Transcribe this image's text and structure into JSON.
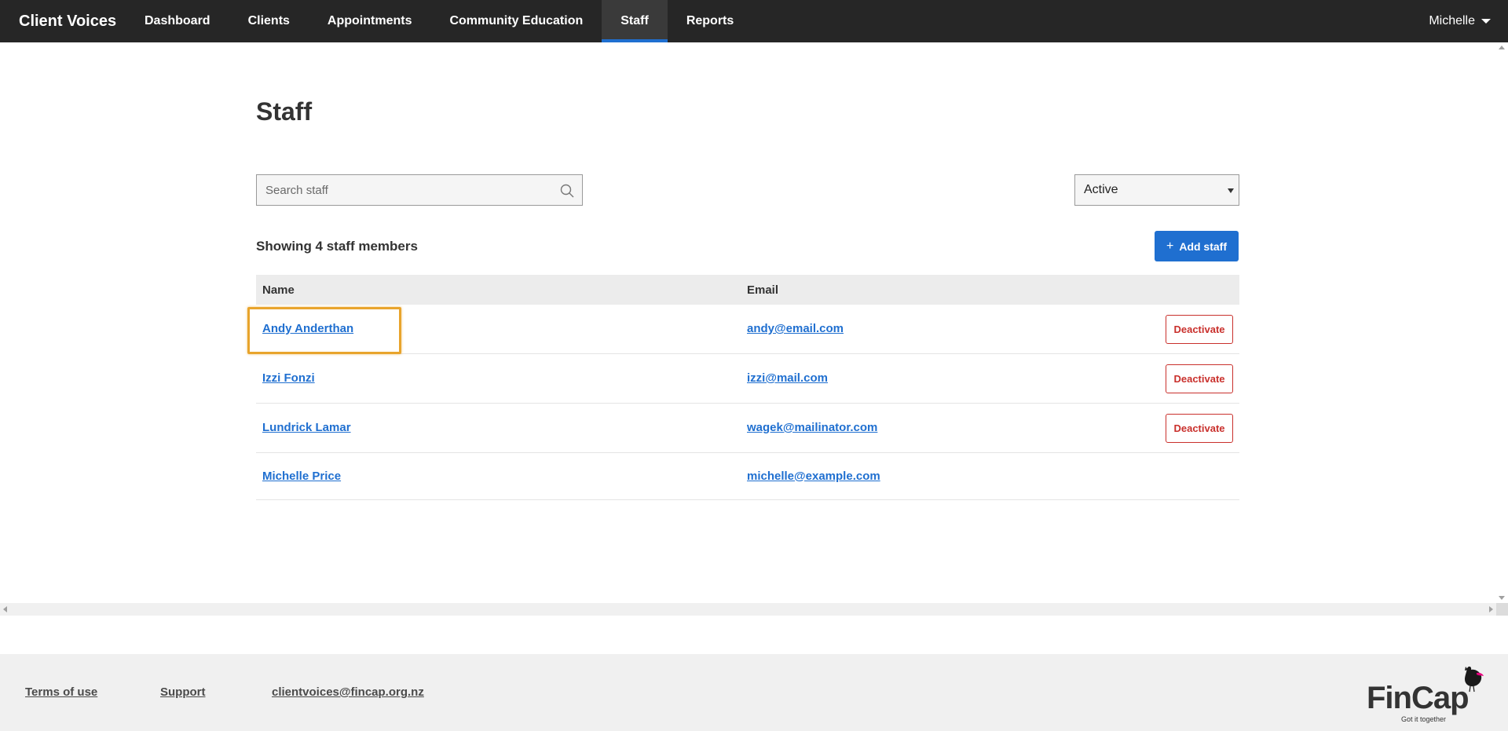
{
  "nav": {
    "brand": "Client Voices",
    "items": [
      {
        "label": "Dashboard"
      },
      {
        "label": "Clients"
      },
      {
        "label": "Appointments"
      },
      {
        "label": "Community Education"
      },
      {
        "label": "Staff"
      },
      {
        "label": "Reports"
      }
    ],
    "active_item": "Staff",
    "user": "Michelle"
  },
  "page": {
    "title": "Staff",
    "search_placeholder": "Search staff",
    "filter_selected": "Active",
    "count_text": "Showing 4 staff members",
    "add_button": "Add staff"
  },
  "table": {
    "headers": {
      "name": "Name",
      "email": "Email"
    },
    "rows": [
      {
        "name": "Andy Anderthan",
        "email": "andy@email.com",
        "action": "Deactivate"
      },
      {
        "name": "Izzi Fonzi",
        "email": "izzi@mail.com",
        "action": "Deactivate"
      },
      {
        "name": "Lundrick Lamar",
        "email": "wagek@mailinator.com",
        "action": "Deactivate"
      },
      {
        "name": "Michelle Price",
        "email": "michelle@example.com",
        "action": null
      }
    ]
  },
  "footer": {
    "terms": "Terms of use",
    "support": "Support",
    "email": "clientvoices@fincap.org.nz",
    "logo_text": "FinCap",
    "logo_tagline": "Got it together"
  },
  "colors": {
    "nav_bg": "#262626",
    "accent": "#1f6fd0",
    "danger": "#c9302c",
    "highlight": "#e8a42c"
  }
}
